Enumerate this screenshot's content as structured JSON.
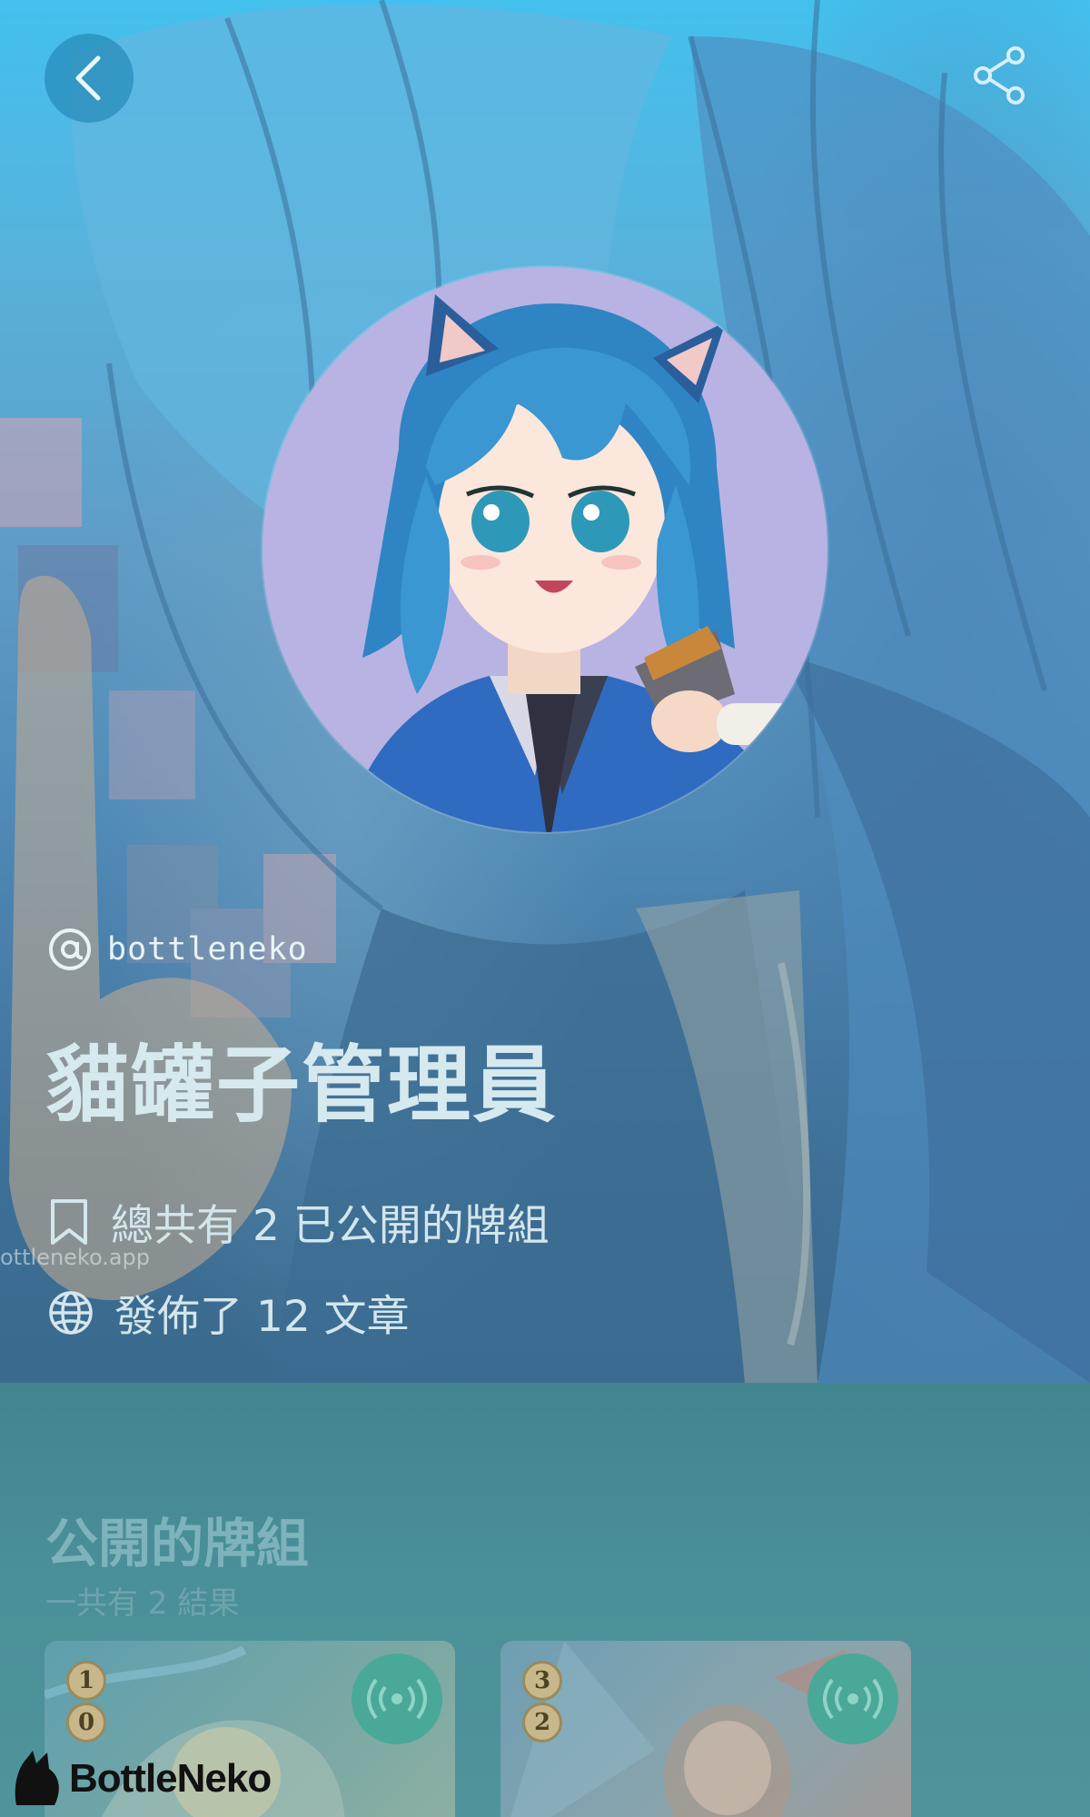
{
  "profile": {
    "handle": "bottleneko",
    "display_name": "貓罐子管理員",
    "decks_stat": "總共有 2 已公開的牌組",
    "posts_stat": "發佈了 12 文章",
    "bg_watermark": "ottleneko.app"
  },
  "decks_section": {
    "title": "公開的牌組",
    "subtitle": "一共有 2 結果",
    "decks": [
      {
        "levels": [
          "1",
          "0"
        ]
      },
      {
        "levels": [
          "3",
          "2"
        ]
      }
    ]
  },
  "brand": {
    "name": "BottleNeko"
  },
  "icons": {
    "back": "chevron-left-icon",
    "share": "share-icon",
    "handle": "at-icon",
    "decks": "bookmark-icon",
    "posts": "globe-icon",
    "live": "broadcast-icon"
  },
  "colors": {
    "sky_top": "#43c0ee",
    "section_bg": "#42858f",
    "badge_green": "#4aa899"
  }
}
